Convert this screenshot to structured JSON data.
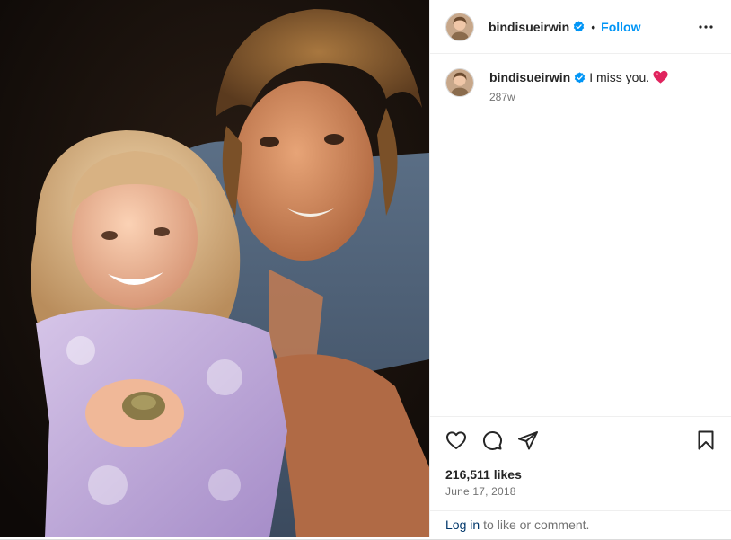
{
  "post": {
    "author": {
      "username": "bindisueirwin",
      "verified": true,
      "avatar_icon": "avatar-photo"
    },
    "header": {
      "separator": "•",
      "follow_label": "Follow",
      "more_icon": "more-options-icon"
    },
    "caption": {
      "username": "bindisueirwin",
      "text": "I miss you.",
      "emoji": "red-heart",
      "time_ago": "287w"
    },
    "actions": {
      "like_icon": "heart-icon",
      "comment_icon": "comment-icon",
      "share_icon": "share-icon",
      "save_icon": "bookmark-icon"
    },
    "likes": "216,511 likes",
    "date": "June 17, 2018",
    "login_prompt": {
      "link_text": "Log in",
      "rest_text": "to like or comment."
    },
    "colors": {
      "accent": "#0095f6",
      "link": "#00376b",
      "muted": "#737373",
      "text": "#262626",
      "verified_badge": "#0095f6",
      "heart_emoji": "#e0245e"
    }
  }
}
